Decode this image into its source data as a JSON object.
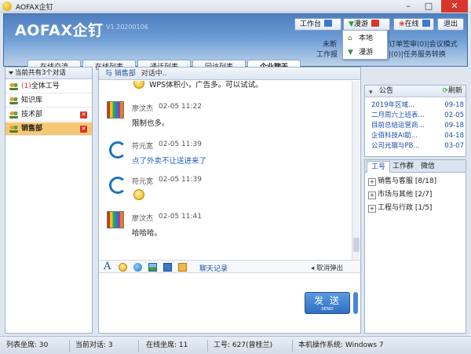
{
  "window": {
    "title": "AOFAX企钉"
  },
  "header": {
    "logo": "AOFAX企钉",
    "version": "V1.20200106",
    "buttons": {
      "workbench": "工作台",
      "roam": "漫游",
      "online": "在线",
      "exit": "退出"
    },
    "info_line1_left": "未断",
    "info_line1_right": "订单签审(0)|会议模式",
    "info_line2_left": "工作报",
    "info_line2_right": "|(0)|任务服务转换"
  },
  "tabs": [
    "在线交流",
    "在线列表",
    "通话列表",
    "回访列表",
    "企业聊天"
  ],
  "roam_menu": [
    "本地",
    "漫游"
  ],
  "sidebar": {
    "header": "当前共有3个对话",
    "items": [
      {
        "badge": "(1)",
        "label": "全体工号"
      },
      {
        "label": "知识库"
      },
      {
        "label": "技术部"
      },
      {
        "label": "销售部"
      }
    ]
  },
  "chat": {
    "header_name": "与 销售部",
    "header_status": "对话中..",
    "messages": [
      {
        "text": "WPS体积小，广告多。可以试试。"
      },
      {
        "sender": "廖汶杰",
        "time": "02-05 11:22",
        "text": "限制也多。"
      },
      {
        "sender": "符元宽",
        "time": "02-05 11:39",
        "text": "点了外卖不让送进来了"
      },
      {
        "sender": "符元宽",
        "time": "02-05 11:39",
        "text": ""
      },
      {
        "sender": "廖汶杰",
        "time": "02-05 11:41",
        "text": "哈哈哈。"
      }
    ],
    "toolbar": {
      "history": "聊天记录",
      "cancel": "取消弹出"
    },
    "send": {
      "label": "发 送",
      "sublabel": "SEND"
    }
  },
  "notice": {
    "title": "公告",
    "refresh": "刷新",
    "items": [
      {
        "title": "2019年区域...",
        "date": "09-18"
      },
      {
        "title": "二月周六上班表...",
        "date": "02-05"
      },
      {
        "title": "目前总结运营商...",
        "date": "09-18"
      },
      {
        "title": "企佰科技AI助...",
        "date": "04-18"
      },
      {
        "title": "公司光猫与PB...",
        "date": "03-07"
      }
    ]
  },
  "right_tabs": [
    "工号",
    "工作群",
    "微信"
  ],
  "groups": [
    "销售与客服 [8/18]",
    "市场与其他 [2/7]",
    "工程与行政 [1/5]"
  ],
  "status_bar": {
    "seats": "列表坐席: 30",
    "sessions": "当前对话: 3",
    "online": "在线坐席: 11",
    "agent": "工号: 627(曾桂兰)",
    "os": "本机操作系统: Windows 7"
  },
  "colors": {
    "accent": "#3a78c9",
    "header": "#5b8ccb",
    "selected": "#f7c873",
    "danger": "#d9352a"
  }
}
